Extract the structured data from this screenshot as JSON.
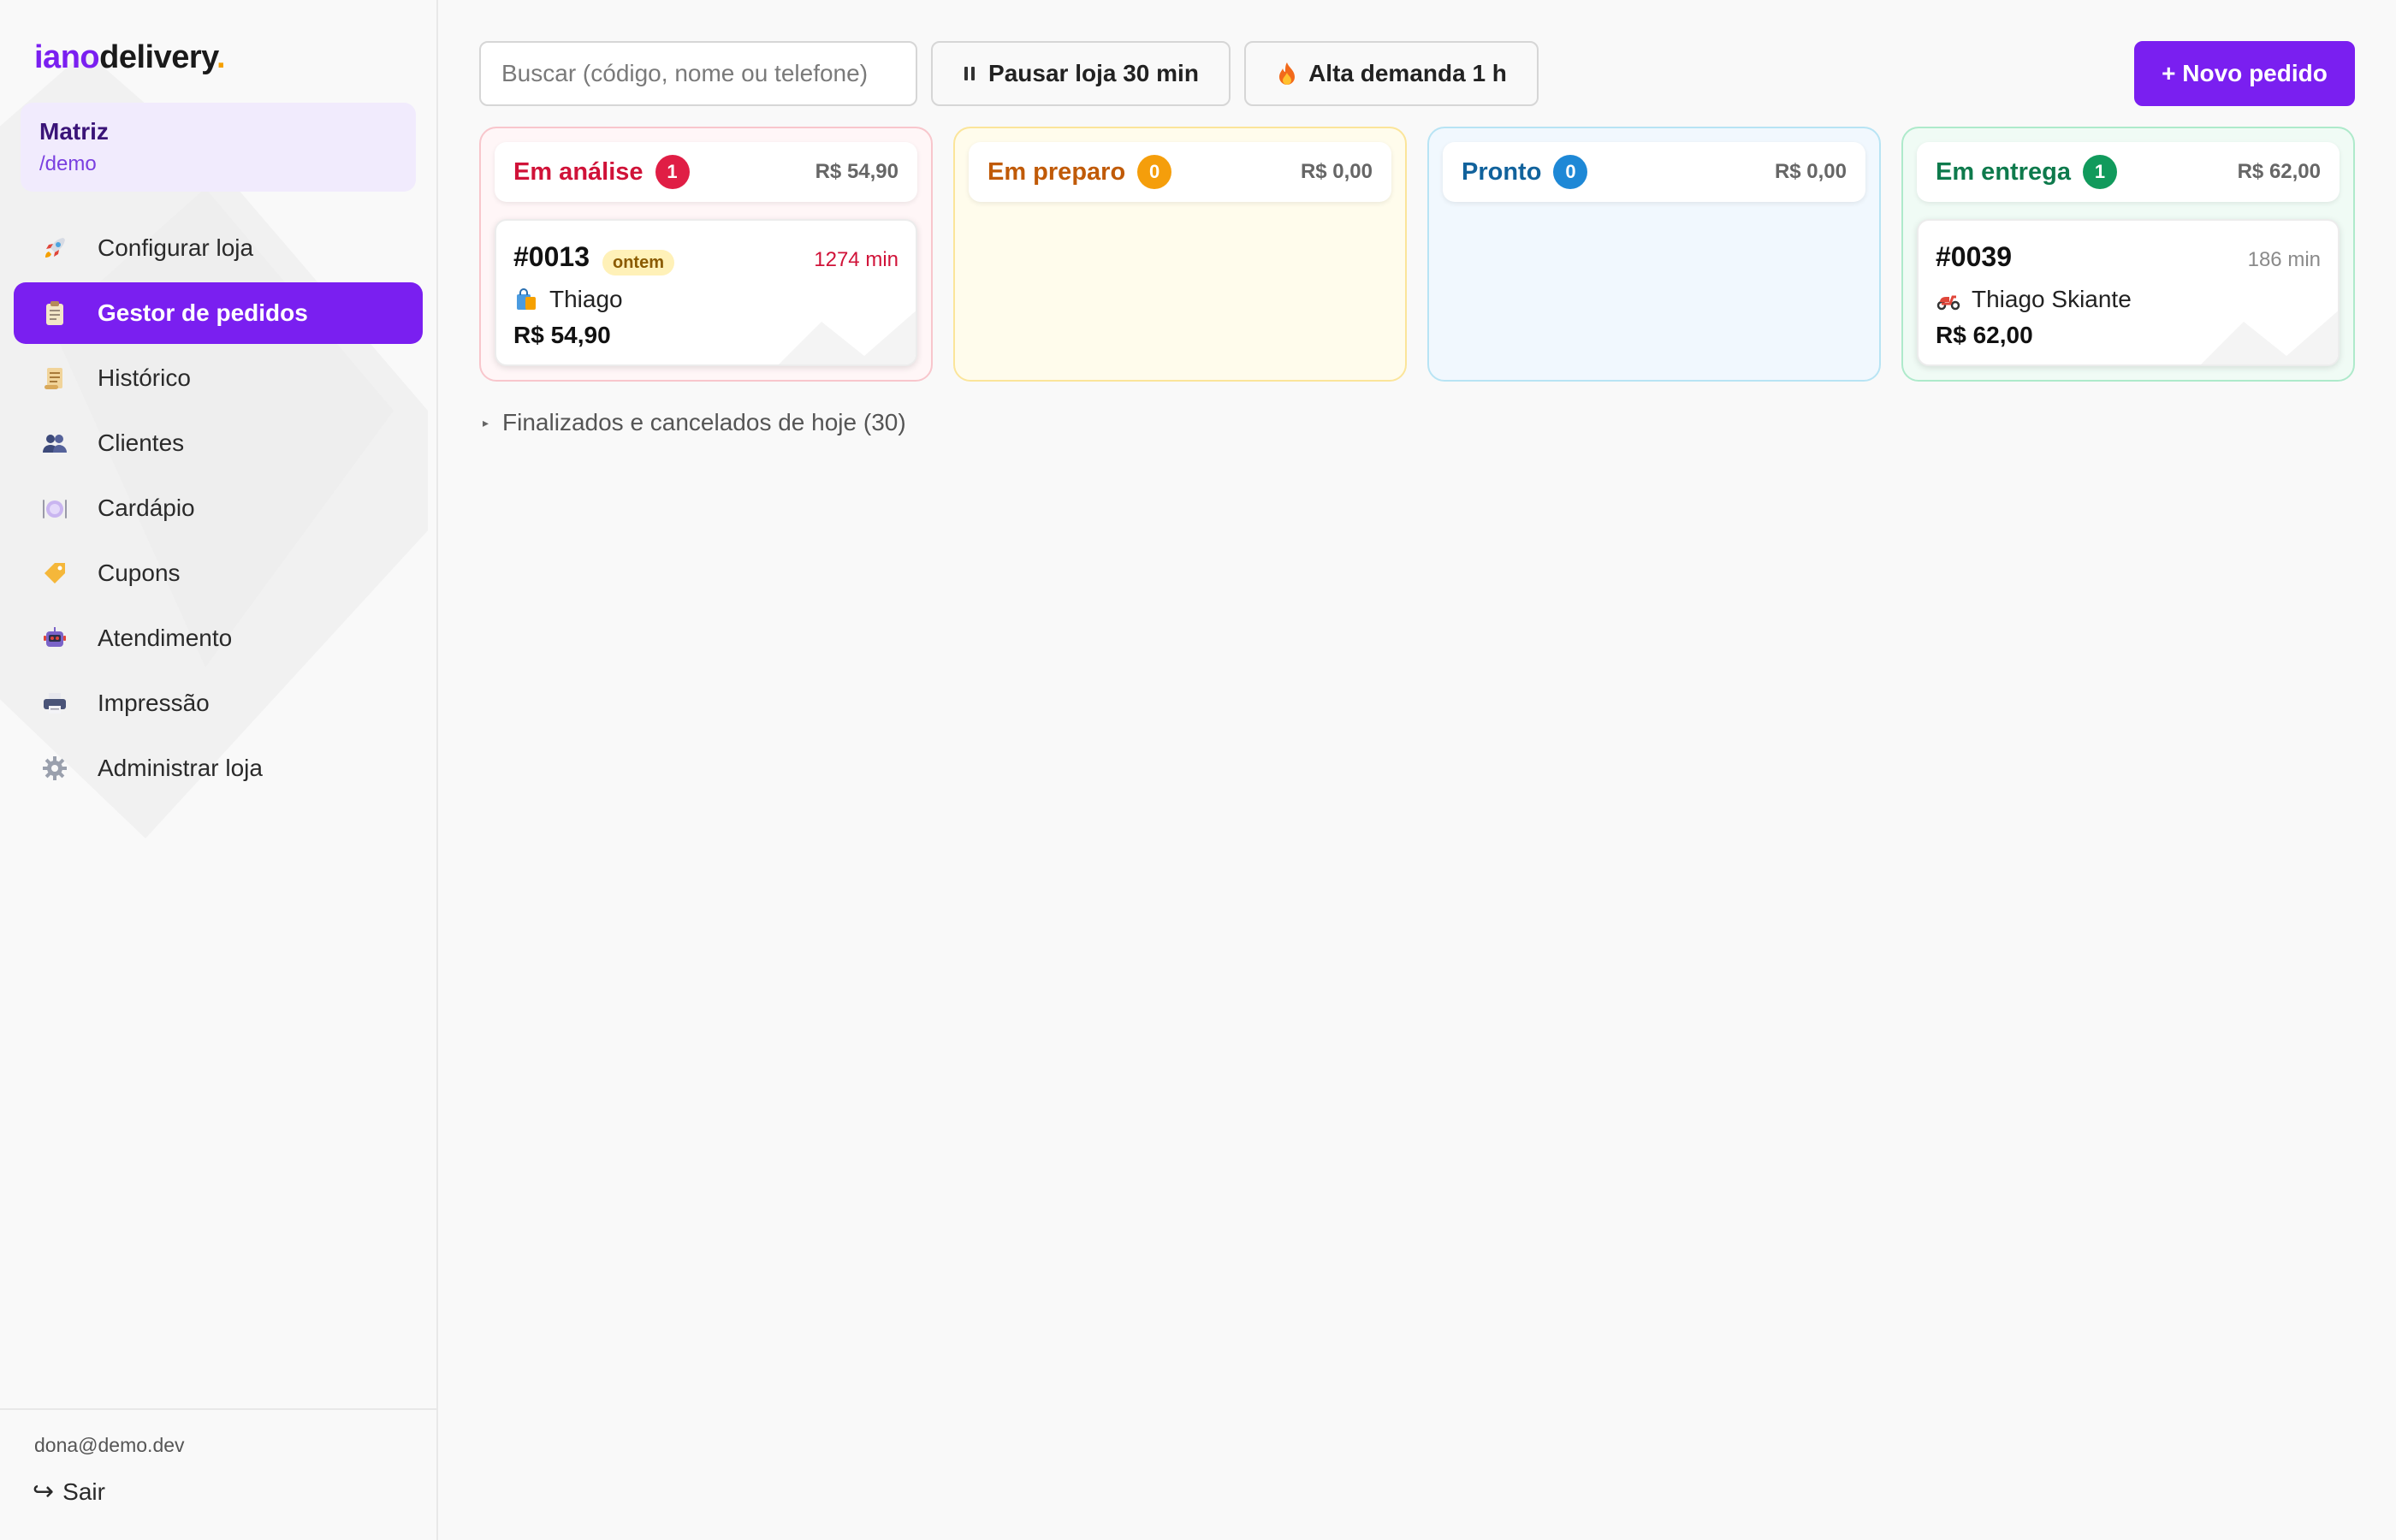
{
  "brand": {
    "part1": "iano",
    "part2": "delivery",
    "dot": "."
  },
  "store": {
    "name": "Matriz",
    "slug": "/demo"
  },
  "sidebar": {
    "items": [
      {
        "label": "Configurar loja",
        "icon": "rocket-icon"
      },
      {
        "label": "Gestor de pedidos",
        "icon": "clipboard-icon",
        "active": true
      },
      {
        "label": "Histórico",
        "icon": "scroll-icon"
      },
      {
        "label": "Clientes",
        "icon": "users-icon"
      },
      {
        "label": "Cardápio",
        "icon": "plate-icon"
      },
      {
        "label": "Cupons",
        "icon": "tag-icon"
      },
      {
        "label": "Atendimento",
        "icon": "robot-icon"
      },
      {
        "label": "Impressão",
        "icon": "printer-icon"
      },
      {
        "label": "Administrar loja",
        "icon": "gear-icon"
      }
    ]
  },
  "user": {
    "email": "dona@demo.dev",
    "logout_label": "Sair"
  },
  "toolbar": {
    "search_placeholder": "Buscar (código, nome ou telefone)",
    "pause_label": "Pausar loja 30 min",
    "demand_label": "Alta demanda 1 h",
    "new_order_label": "+ Novo pedido"
  },
  "columns": [
    {
      "title": "Em análise",
      "count": "1",
      "total": "R$ 54,90",
      "color": "#e01e45",
      "orders": [
        {
          "code": "#0013",
          "tag": "ontem",
          "time": "1274 min",
          "time_color": "#d01238",
          "customer": "Thiago",
          "customer_icon": "shopping-bag-icon",
          "price": "R$ 54,90"
        }
      ]
    },
    {
      "title": "Em preparo",
      "count": "0",
      "total": "R$ 0,00",
      "color": "#f59e0b",
      "orders": []
    },
    {
      "title": "Pronto",
      "count": "0",
      "total": "R$ 0,00",
      "color": "#1e88d6",
      "orders": []
    },
    {
      "title": "Em entrega",
      "count": "1",
      "total": "R$ 62,00",
      "color": "#119a5c",
      "orders": [
        {
          "code": "#0039",
          "time": "186 min",
          "time_color": "#8a8a8a",
          "customer": "Thiago Skiante",
          "customer_icon": "scooter-icon",
          "price": "R$ 62,00"
        }
      ]
    }
  ],
  "finished": {
    "label": "Finalizados e cancelados de hoje (30)"
  },
  "colors": {
    "accent": "#7a1ff0",
    "logo_dot": "#f5a000"
  }
}
